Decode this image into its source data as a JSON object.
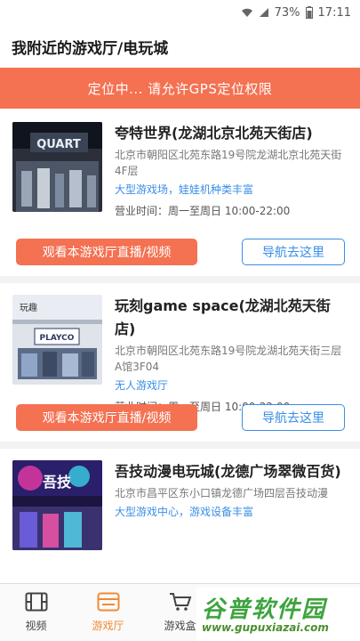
{
  "status_bar": {
    "battery": "73%",
    "time": "17:11"
  },
  "header": {
    "title": "我附近的游戏厅/电玩城"
  },
  "banner": {
    "text": "定位中... 请允许GPS定位权限"
  },
  "venues": [
    {
      "name": "夸特世界(龙湖北京北苑天街店)",
      "address": "北京市朝阳区北苑东路19号院龙湖北京北苑天街4F层",
      "tags": "大型游戏场，娃娃机种类丰富",
      "hours": "营业时间：周一至周日 10:00-22:00",
      "live_button": "观看本游戏厅直播/视频",
      "nav_button": "导航去这里",
      "image_sign": "QUART"
    },
    {
      "name": "玩刻game space(龙湖北苑天街店)",
      "address": "北京市朝阳区北苑东路19号院龙湖北苑天街三层A馆3F04",
      "tags": "无人游戏厅",
      "hours": "营业时间：周一至周日 10:00-22:00",
      "live_button": "观看本游戏厅直播/视频",
      "nav_button": "导航去这里",
      "image_sign": "PLAYCO"
    },
    {
      "name": "吾技动漫电玩城(龙德广场翠微百货)",
      "address": "北京市昌平区东小口镇龙德广场四层吾技动漫",
      "tags": "大型游戏中心，游戏设备丰富",
      "hours": "",
      "live_button": "",
      "nav_button": "",
      "image_sign": "吾技"
    }
  ],
  "tabs": [
    {
      "label": "视频",
      "icon": "film-icon"
    },
    {
      "label": "游戏厅",
      "icon": "arcade-icon",
      "active": true
    },
    {
      "label": "游戏盒",
      "icon": "cart-icon"
    }
  ],
  "watermark": {
    "title": "谷普软件园",
    "url": "www.gupuxiazai.com"
  },
  "colors": {
    "accent": "#f47152",
    "link": "#3a8ee6",
    "active_tab": "#f08a33"
  }
}
